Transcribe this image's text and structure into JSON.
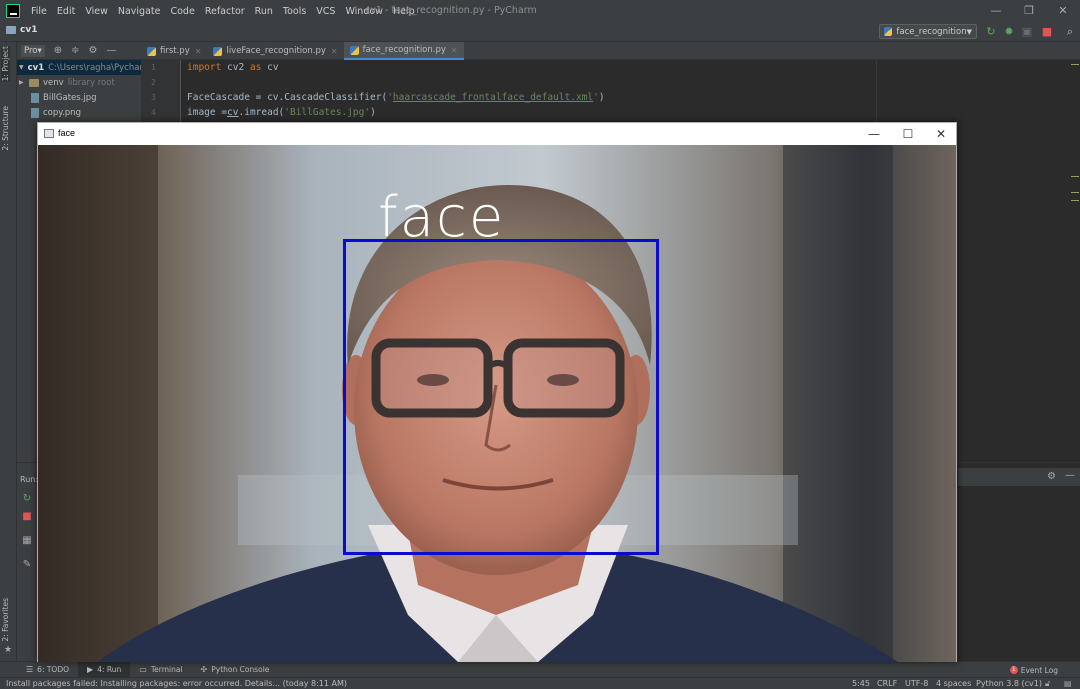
{
  "app": {
    "window_title": "cv1 - face_recognition.py - PyCharm",
    "menu": [
      "File",
      "Edit",
      "View",
      "Navigate",
      "Code",
      "Refactor",
      "Run",
      "Tools",
      "VCS",
      "Window",
      "Help"
    ],
    "project_name": "cv1",
    "run_config": "face_recognition"
  },
  "project_panel": {
    "dropdown": "Pro▾",
    "root_label": "cv1",
    "root_path": "C:\\Users\\ragha\\PycharmP",
    "items": [
      {
        "label": "venv",
        "note": "library root"
      },
      {
        "label": "BillGates.jpg"
      },
      {
        "label": "copy.png"
      }
    ]
  },
  "editor": {
    "tabs": [
      {
        "label": "first.py",
        "active": false
      },
      {
        "label": "liveFace_recognition.py",
        "active": false
      },
      {
        "label": "face_recognition.py",
        "active": true
      }
    ],
    "line_numbers": [
      "1",
      "2",
      "3",
      "4"
    ],
    "code": {
      "l1_kw1": "import",
      "l1_rest1": " cv2 ",
      "l1_kw2": "as",
      "l1_rest2": " cv",
      "l3_pre": "FaceCascade = cv.CascadeClassifier(",
      "l3_q1": "'",
      "l3_str": "haarcascade_frontalface_default.xml",
      "l3_q2": "'",
      "l3_post": ")",
      "l4_pre": "image =",
      "l4_mid": "cv",
      "l4_rest": ".imread(",
      "l4_str": "'BillGates.jpg'",
      "l4_post": ")"
    }
  },
  "left_strip": {
    "project_tab": "1: Project",
    "structure_tab": "2: Structure",
    "favorites_tab": "2: Favorites"
  },
  "run_panel": {
    "label": "Run:"
  },
  "bottom_tabs": [
    {
      "label": "6: TODO"
    },
    {
      "label": "4: Run",
      "active": true
    },
    {
      "label": "Terminal"
    },
    {
      "label": "Python Console"
    }
  ],
  "event_log": {
    "label": "Event Log",
    "count": "1"
  },
  "status": {
    "message": "Install packages failed: Installing packages: error occurred. Details... (today 8:11 AM)",
    "position": "5:45",
    "line_sep": "CRLF",
    "encoding": "UTF-8",
    "indent": "4 spaces",
    "interpreter": "Python 3.8 (cv1)"
  },
  "cv_window": {
    "title": "face",
    "detection_label": "face",
    "box_color": "#0a0ad2"
  },
  "colors": {
    "ide_bg": "#2b2b2b",
    "panel_bg": "#3c3f41",
    "keyword": "#cc7832",
    "string": "#6a8759"
  }
}
